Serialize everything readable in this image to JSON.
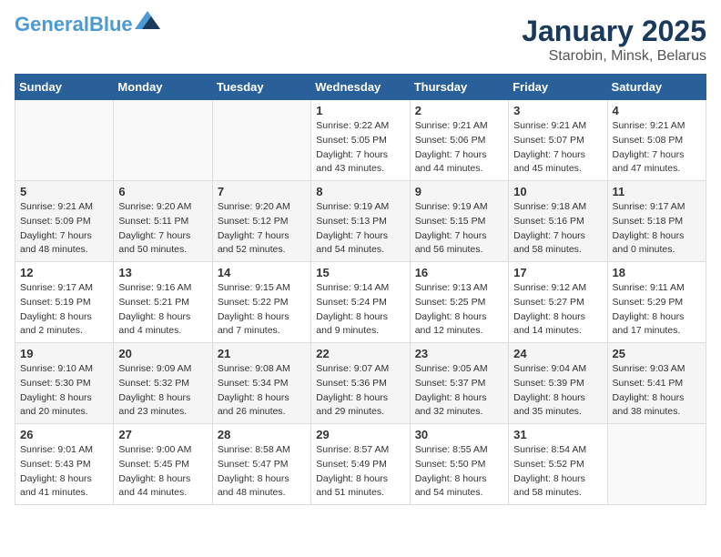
{
  "logo": {
    "line1": "General",
    "line2": "Blue"
  },
  "title": "January 2025",
  "subtitle": "Starobin, Minsk, Belarus",
  "weekdays": [
    "Sunday",
    "Monday",
    "Tuesday",
    "Wednesday",
    "Thursday",
    "Friday",
    "Saturday"
  ],
  "weeks": [
    [
      {
        "day": "",
        "info": ""
      },
      {
        "day": "",
        "info": ""
      },
      {
        "day": "",
        "info": ""
      },
      {
        "day": "1",
        "info": "Sunrise: 9:22 AM\nSunset: 5:05 PM\nDaylight: 7 hours and 43 minutes."
      },
      {
        "day": "2",
        "info": "Sunrise: 9:21 AM\nSunset: 5:06 PM\nDaylight: 7 hours and 44 minutes."
      },
      {
        "day": "3",
        "info": "Sunrise: 9:21 AM\nSunset: 5:07 PM\nDaylight: 7 hours and 45 minutes."
      },
      {
        "day": "4",
        "info": "Sunrise: 9:21 AM\nSunset: 5:08 PM\nDaylight: 7 hours and 47 minutes."
      }
    ],
    [
      {
        "day": "5",
        "info": "Sunrise: 9:21 AM\nSunset: 5:09 PM\nDaylight: 7 hours and 48 minutes."
      },
      {
        "day": "6",
        "info": "Sunrise: 9:20 AM\nSunset: 5:11 PM\nDaylight: 7 hours and 50 minutes."
      },
      {
        "day": "7",
        "info": "Sunrise: 9:20 AM\nSunset: 5:12 PM\nDaylight: 7 hours and 52 minutes."
      },
      {
        "day": "8",
        "info": "Sunrise: 9:19 AM\nSunset: 5:13 PM\nDaylight: 7 hours and 54 minutes."
      },
      {
        "day": "9",
        "info": "Sunrise: 9:19 AM\nSunset: 5:15 PM\nDaylight: 7 hours and 56 minutes."
      },
      {
        "day": "10",
        "info": "Sunrise: 9:18 AM\nSunset: 5:16 PM\nDaylight: 7 hours and 58 minutes."
      },
      {
        "day": "11",
        "info": "Sunrise: 9:17 AM\nSunset: 5:18 PM\nDaylight: 8 hours and 0 minutes."
      }
    ],
    [
      {
        "day": "12",
        "info": "Sunrise: 9:17 AM\nSunset: 5:19 PM\nDaylight: 8 hours and 2 minutes."
      },
      {
        "day": "13",
        "info": "Sunrise: 9:16 AM\nSunset: 5:21 PM\nDaylight: 8 hours and 4 minutes."
      },
      {
        "day": "14",
        "info": "Sunrise: 9:15 AM\nSunset: 5:22 PM\nDaylight: 8 hours and 7 minutes."
      },
      {
        "day": "15",
        "info": "Sunrise: 9:14 AM\nSunset: 5:24 PM\nDaylight: 8 hours and 9 minutes."
      },
      {
        "day": "16",
        "info": "Sunrise: 9:13 AM\nSunset: 5:25 PM\nDaylight: 8 hours and 12 minutes."
      },
      {
        "day": "17",
        "info": "Sunrise: 9:12 AM\nSunset: 5:27 PM\nDaylight: 8 hours and 14 minutes."
      },
      {
        "day": "18",
        "info": "Sunrise: 9:11 AM\nSunset: 5:29 PM\nDaylight: 8 hours and 17 minutes."
      }
    ],
    [
      {
        "day": "19",
        "info": "Sunrise: 9:10 AM\nSunset: 5:30 PM\nDaylight: 8 hours and 20 minutes."
      },
      {
        "day": "20",
        "info": "Sunrise: 9:09 AM\nSunset: 5:32 PM\nDaylight: 8 hours and 23 minutes."
      },
      {
        "day": "21",
        "info": "Sunrise: 9:08 AM\nSunset: 5:34 PM\nDaylight: 8 hours and 26 minutes."
      },
      {
        "day": "22",
        "info": "Sunrise: 9:07 AM\nSunset: 5:36 PM\nDaylight: 8 hours and 29 minutes."
      },
      {
        "day": "23",
        "info": "Sunrise: 9:05 AM\nSunset: 5:37 PM\nDaylight: 8 hours and 32 minutes."
      },
      {
        "day": "24",
        "info": "Sunrise: 9:04 AM\nSunset: 5:39 PM\nDaylight: 8 hours and 35 minutes."
      },
      {
        "day": "25",
        "info": "Sunrise: 9:03 AM\nSunset: 5:41 PM\nDaylight: 8 hours and 38 minutes."
      }
    ],
    [
      {
        "day": "26",
        "info": "Sunrise: 9:01 AM\nSunset: 5:43 PM\nDaylight: 8 hours and 41 minutes."
      },
      {
        "day": "27",
        "info": "Sunrise: 9:00 AM\nSunset: 5:45 PM\nDaylight: 8 hours and 44 minutes."
      },
      {
        "day": "28",
        "info": "Sunrise: 8:58 AM\nSunset: 5:47 PM\nDaylight: 8 hours and 48 minutes."
      },
      {
        "day": "29",
        "info": "Sunrise: 8:57 AM\nSunset: 5:49 PM\nDaylight: 8 hours and 51 minutes."
      },
      {
        "day": "30",
        "info": "Sunrise: 8:55 AM\nSunset: 5:50 PM\nDaylight: 8 hours and 54 minutes."
      },
      {
        "day": "31",
        "info": "Sunrise: 8:54 AM\nSunset: 5:52 PM\nDaylight: 8 hours and 58 minutes."
      },
      {
        "day": "",
        "info": ""
      }
    ]
  ]
}
